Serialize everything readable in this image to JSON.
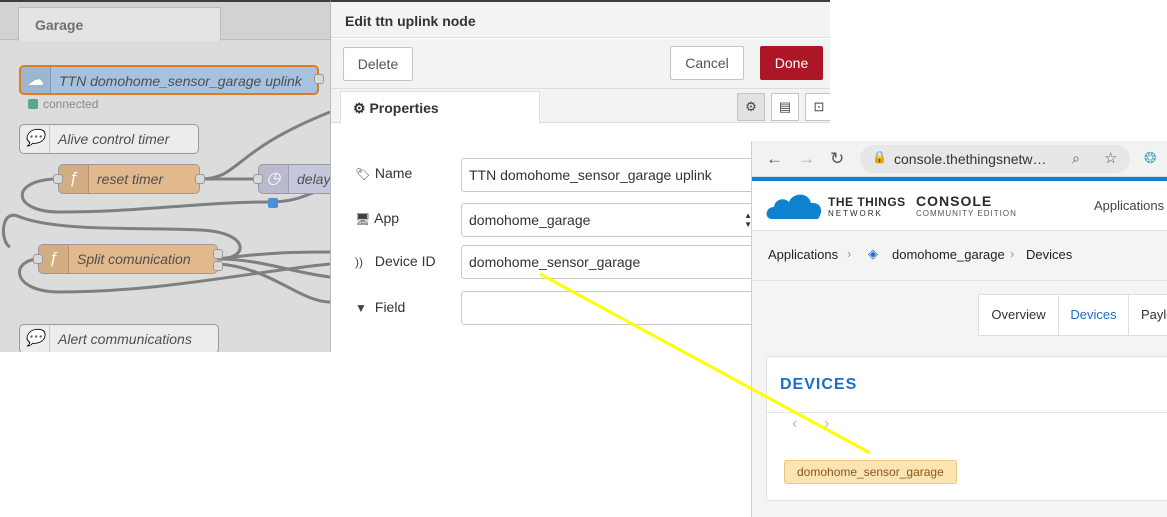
{
  "flow": {
    "tab_label": "Garage",
    "nodes": [
      {
        "label": "TTN domohome_sensor_garage uplink",
        "status": "connected"
      },
      {
        "label": "Alive control timer"
      },
      {
        "label": "reset timer"
      },
      {
        "label": "delay"
      },
      {
        "label": "Split comunication"
      },
      {
        "label": "Alert communications"
      }
    ],
    "colors": {
      "ttn_node": "#a6c2de",
      "function_node": "#e2b98c",
      "delay_node": "#c6c6dc",
      "comment_node": "#ececec",
      "selected_border": "#e07b22"
    }
  },
  "editor": {
    "title": "Edit ttn uplink node",
    "delete_label": "Delete",
    "cancel_label": "Cancel",
    "done_label": "Done",
    "properties_tab": "Properties",
    "icons": [
      "gear-icon",
      "document-icon",
      "frame-icon"
    ],
    "fields": [
      {
        "label": "Name",
        "value": "TTN domohome_sensor_garage uplink",
        "icon": "tag-icon"
      },
      {
        "label": "App",
        "value": "domohome_garage",
        "icon": "monitor-icon"
      },
      {
        "label": "Device ID",
        "value": "domohome_sensor_garage",
        "icon": "rss-icon"
      },
      {
        "label": "Field",
        "value": "",
        "icon": "filter-icon"
      }
    ]
  },
  "browser": {
    "url": "console.thethingsnetw…"
  },
  "ttn": {
    "logo_line1": "THE THINGS",
    "logo_line2": "NETWORK",
    "console_label": "CONSOLE",
    "edition_label": "COMMUNITY EDITION",
    "nav_applications": "Applications",
    "breadcrumb": [
      "Applications",
      "domohome_garage",
      "Devices"
    ],
    "tabs": [
      "Overview",
      "Devices",
      "Paylo"
    ],
    "active_tab": "Devices",
    "card_title": "DEVICES",
    "device": "domohome_sensor_garage",
    "accent_color": "#1a6ec8"
  },
  "annotation": {
    "arrow_color": "#ffff00"
  }
}
